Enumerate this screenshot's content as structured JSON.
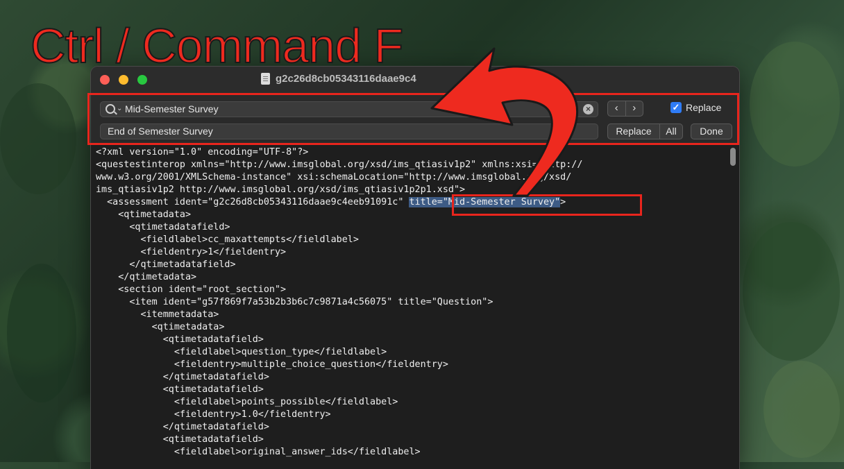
{
  "annotation": {
    "text": "Ctrl / Command F",
    "color": "#ee2a1f"
  },
  "window": {
    "title": "g2c26d8cb05343116daae9c4",
    "title_icon": "document-icon"
  },
  "find_bar": {
    "search_value": "Mid-Semester Survey",
    "replace_value": "End of Semester Survey",
    "replace_checkbox_label": "Replace",
    "replace_checked": true,
    "prev_label": "‹",
    "next_label": "›",
    "replace_button": "Replace",
    "all_button": "All",
    "done_button": "Done"
  },
  "editor": {
    "lines": [
      "<?xml version=\"1.0\" encoding=\"UTF-8\"?>",
      "<questestinterop xmlns=\"http://www.imsglobal.org/xsd/ims_qtiasiv1p2\" xmlns:xsi=\"http://",
      "www.w3.org/2001/XMLSchema-instance\" xsi:schemaLocation=\"http://www.imsglobal.org/xsd/",
      "ims_qtiasiv1p2 http://www.imsglobal.org/xsd/ims_qtiasiv1p2p1.xsd\">",
      "  <assessment ident=\"g2c26d8cb05343116daae9c4eeb91091c\" ",
      "    <qtimetadata>",
      "      <qtimetadatafield>",
      "        <fieldlabel>cc_maxattempts</fieldlabel>",
      "        <fieldentry>1</fieldentry>",
      "      </qtimetadatafield>",
      "    </qtimetadata>",
      "    <section ident=\"root_section\">",
      "      <item ident=\"g57f869f7a53b2b3b6c7c9871a4c56075\" title=\"Question\">",
      "        <itemmetadata>",
      "          <qtimetadata>",
      "            <qtimetadatafield>",
      "              <fieldlabel>question_type</fieldlabel>",
      "              <fieldentry>multiple_choice_question</fieldentry>",
      "            </qtimetadatafield>",
      "            <qtimetadatafield>",
      "              <fieldlabel>points_possible</fieldlabel>",
      "              <fieldentry>1.0</fieldentry>",
      "            </qtimetadatafield>",
      "            <qtimetadatafield>",
      "              <fieldlabel>original_answer_ids</fieldlabel>"
    ],
    "highlight_text": "title=\"Mid-Semester Survey\"",
    "line4_suffix": ">"
  }
}
